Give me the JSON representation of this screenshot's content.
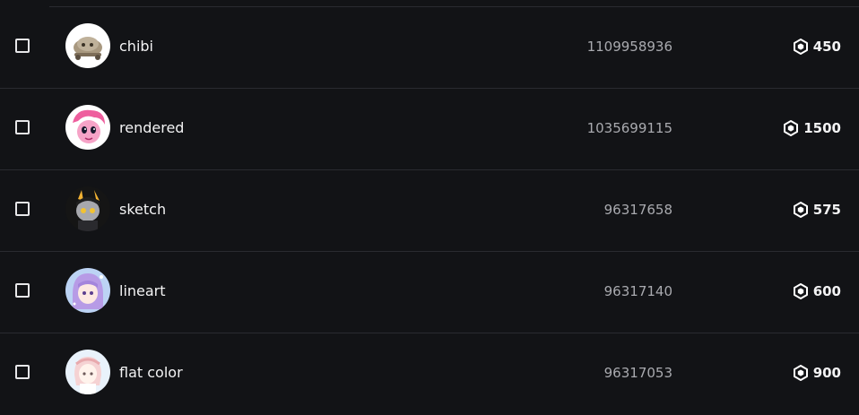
{
  "items": [
    {
      "name": "chibi",
      "id": "1109958936",
      "price": "450",
      "avatar": {
        "bg": "#ffffff",
        "accent": "#8f7e66",
        "icon": "chibi-avatar"
      }
    },
    {
      "name": "rendered",
      "id": "1035699115",
      "price": "1500",
      "avatar": {
        "bg": "#ffffff",
        "accent": "#f06fa7",
        "icon": "rendered-avatar"
      }
    },
    {
      "name": "sketch",
      "id": "96317658",
      "price": "575",
      "avatar": {
        "bg": "#1a1a1a",
        "accent": "#9a9aa0",
        "icon": "sketch-avatar"
      }
    },
    {
      "name": "lineart",
      "id": "96317140",
      "price": "600",
      "avatar": {
        "bg": "#bcd3f4",
        "accent": "#b79be6",
        "icon": "lineart-avatar"
      }
    },
    {
      "name": "flat color",
      "id": "96317053",
      "price": "900",
      "avatar": {
        "bg": "#e9f2fb",
        "accent": "#f3c7c9",
        "icon": "flat-color-avatar"
      }
    }
  ],
  "currency_icon": "robux-icon",
  "colors": {
    "background": "#121316",
    "divider": "#2a2b30",
    "text": "#f3f3f4",
    "muted": "#a9aaaf"
  }
}
